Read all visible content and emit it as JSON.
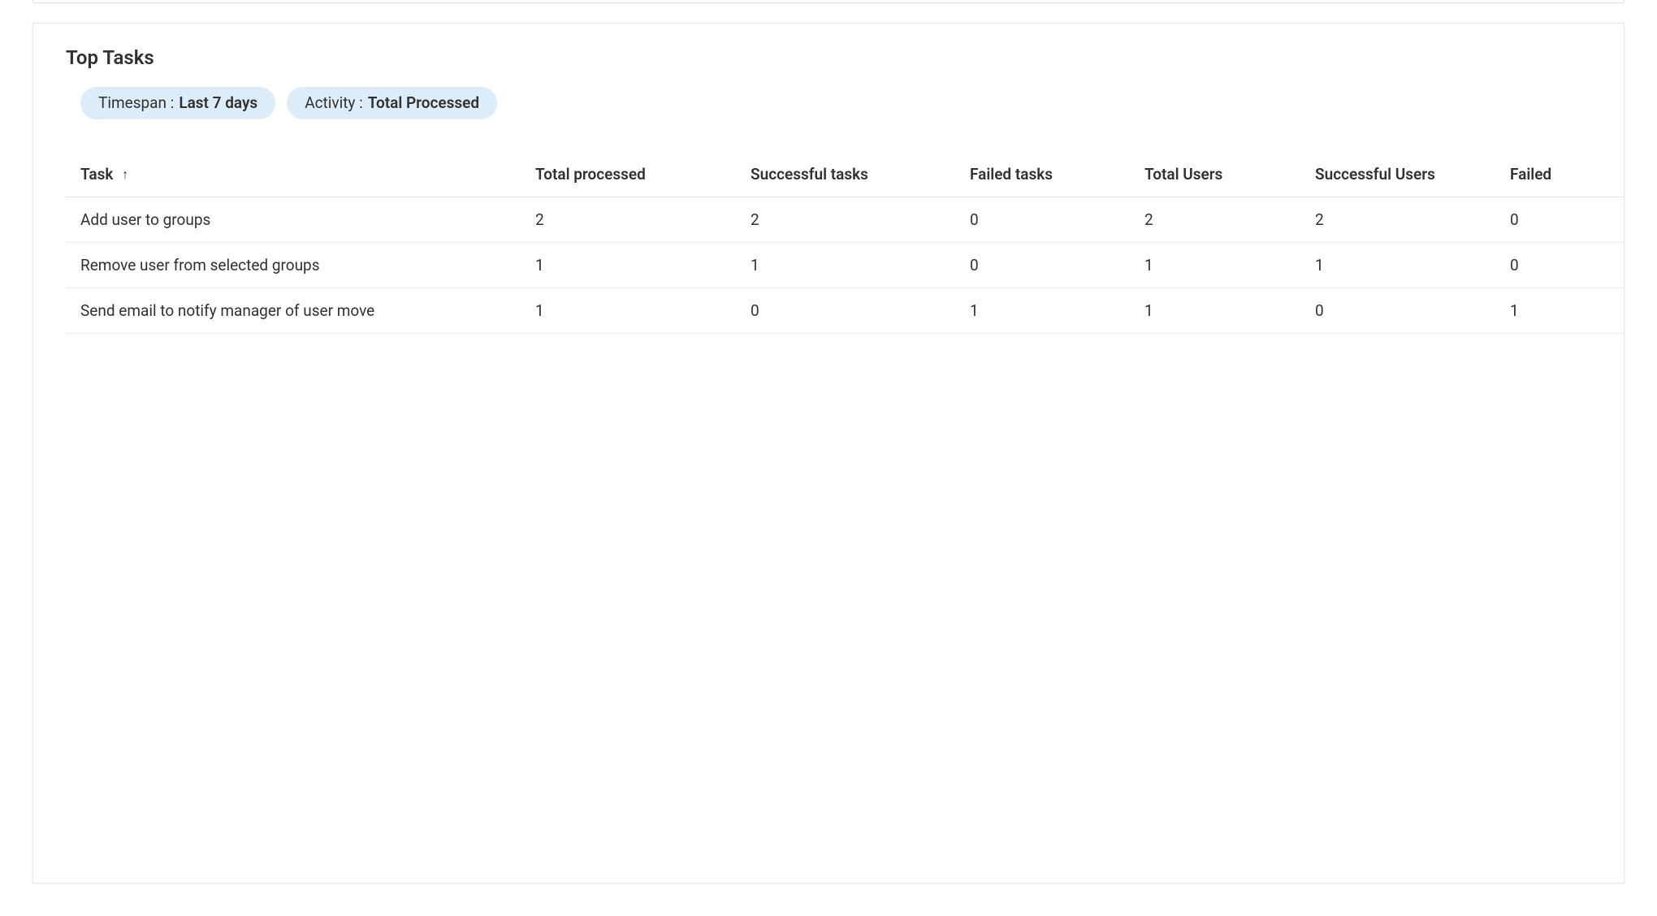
{
  "card": {
    "title": "Top Tasks"
  },
  "filters": {
    "timespan": {
      "label": "Timespan : ",
      "value": "Last 7 days"
    },
    "activity": {
      "label": "Activity : ",
      "value": "Total Processed"
    }
  },
  "table": {
    "columns": {
      "task": "Task",
      "total_processed": "Total processed",
      "successful_tasks": "Successful tasks",
      "failed_tasks": "Failed tasks",
      "total_users": "Total Users",
      "successful_users": "Successful Users",
      "failed_users": "Failed"
    },
    "sort": {
      "column": "task",
      "arrow": "↑"
    },
    "rows": [
      {
        "task": "Add user to groups",
        "total_processed": "2",
        "successful_tasks": "2",
        "failed_tasks": "0",
        "total_users": "2",
        "successful_users": "2",
        "failed_users": "0"
      },
      {
        "task": "Remove user from selected groups",
        "total_processed": "1",
        "successful_tasks": "1",
        "failed_tasks": "0",
        "total_users": "1",
        "successful_users": "1",
        "failed_users": "0"
      },
      {
        "task": "Send email to notify manager of user move",
        "total_processed": "1",
        "successful_tasks": "0",
        "failed_tasks": "1",
        "total_users": "1",
        "successful_users": "0",
        "failed_users": "1"
      }
    ]
  }
}
